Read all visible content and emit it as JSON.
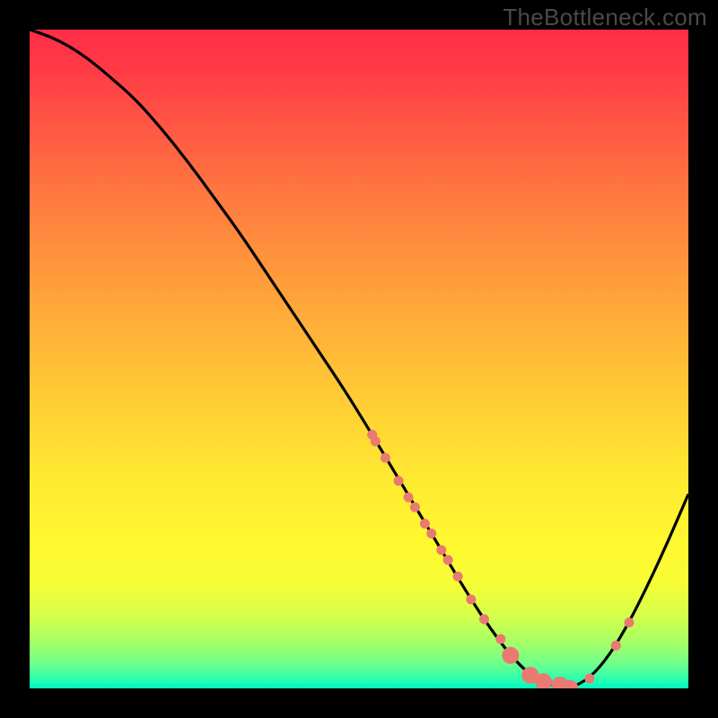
{
  "watermark": "TheBottleneck.com",
  "colors": {
    "curve_stroke": "#000000",
    "marker_fill": "#e87a72",
    "marker_stroke": "#e87a72",
    "background_black": "#000000"
  },
  "chart_data": {
    "type": "line",
    "title": "",
    "xlabel": "",
    "ylabel": "",
    "xlim": [
      0,
      100
    ],
    "ylim": [
      0,
      100
    ],
    "grid": false,
    "series": [
      {
        "name": "curve",
        "x": [
          0,
          3,
          6,
          9,
          12,
          16,
          20,
          24,
          28,
          32,
          36,
          40,
          44,
          48,
          52,
          55,
          58,
          61,
          64,
          67,
          70,
          73,
          76,
          79,
          82,
          85,
          88,
          91,
          94,
          97,
          100
        ],
        "y": [
          100,
          99,
          97.5,
          95.5,
          93,
          89.5,
          85,
          80,
          74.5,
          69,
          63,
          57,
          51,
          45,
          38.5,
          33.5,
          28.5,
          23.5,
          18.5,
          13.5,
          9,
          5,
          2,
          0.5,
          0,
          1.5,
          5,
          10,
          16,
          22.5,
          29.5
        ]
      }
    ],
    "markers": {
      "name": "highlighted-points",
      "x": [
        52,
        52.5,
        54,
        56,
        57.5,
        58.5,
        60,
        61,
        62.5,
        63.5,
        65,
        67,
        69,
        71.5,
        73,
        76,
        78,
        80.5,
        82,
        85,
        89,
        91
      ],
      "y": [
        38.5,
        37.5,
        35,
        31.5,
        29,
        27.5,
        25,
        23.5,
        21,
        19.5,
        17,
        13.5,
        10.5,
        7.5,
        5,
        2,
        1,
        0.5,
        0,
        1.5,
        6.5,
        10
      ],
      "radius_small": 5,
      "radius_large": 9,
      "large_indices": [
        14,
        15,
        16,
        17,
        18
      ]
    }
  }
}
